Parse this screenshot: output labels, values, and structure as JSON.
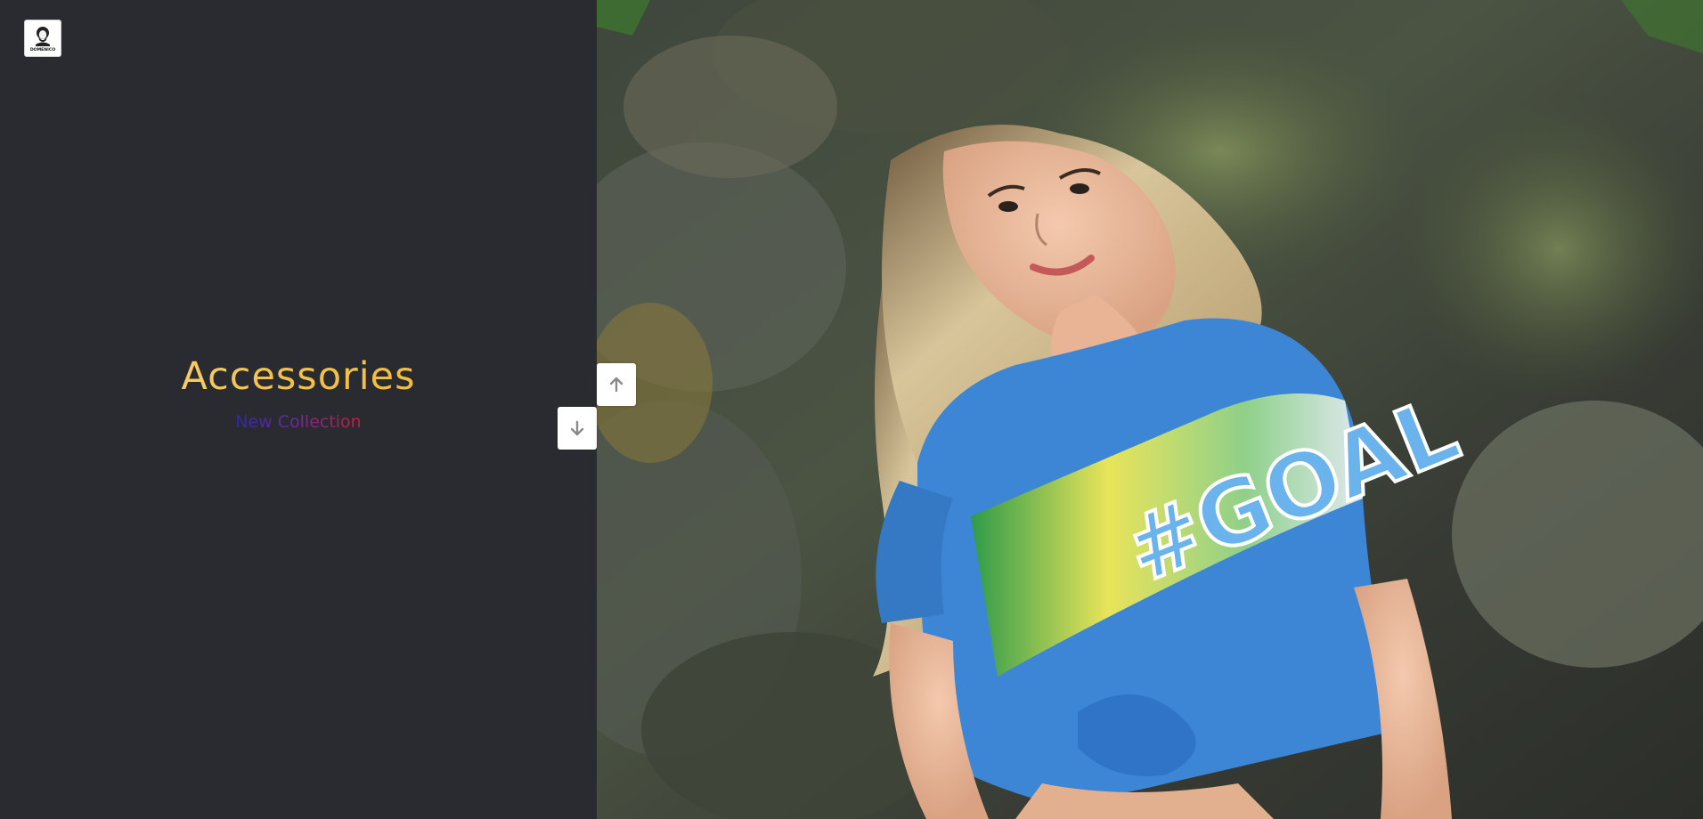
{
  "brand": {
    "logo_icon": "domenico-logo-icon",
    "logo_text": "DOMENICO"
  },
  "hero": {
    "title": "Accessories",
    "subtitle": "New Collection"
  },
  "navigation": {
    "prev_icon": "arrow-up-icon",
    "next_icon": "arrow-down-icon"
  },
  "slide_image": {
    "shirt_text": "#GOAL"
  },
  "colors": {
    "panel_background": "#2a2b30",
    "title_gradient": [
      "#fbe4a0",
      "#f2b92f"
    ],
    "subtitle_gradient": [
      "#2b2ba8",
      "#c2203a"
    ],
    "shirt_blue": "#3d86d6"
  }
}
